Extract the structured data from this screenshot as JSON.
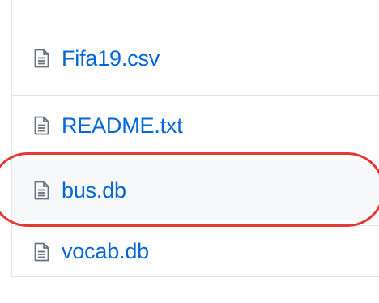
{
  "files": [
    {
      "name": "Fifa19.csv",
      "icon": "file-text-icon"
    },
    {
      "name": "README.txt",
      "icon": "file-text-icon"
    },
    {
      "name": "bus.db",
      "icon": "file-text-icon"
    },
    {
      "name": "vocab.db",
      "icon": "file-text-icon"
    }
  ],
  "colors": {
    "link": "#0366d6",
    "border": "#e1e4e8",
    "highlight": "#e53935",
    "hover_row": "#f6f8fa"
  }
}
